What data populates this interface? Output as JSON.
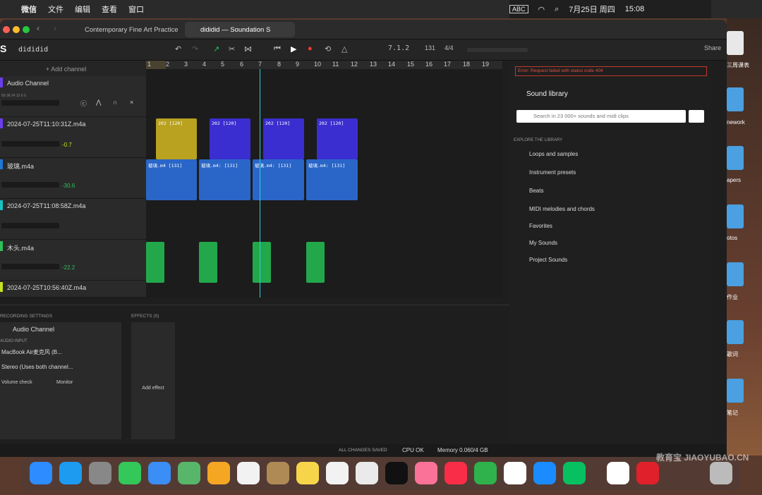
{
  "menubar": {
    "apple": "",
    "items": [
      "微信",
      "文件",
      "编辑",
      "查看",
      "窗口"
    ],
    "input": "ABC",
    "date": "7月25日 周四",
    "time": "15:08"
  },
  "browser": {
    "tab1": "Contemporary Fine Art Practice",
    "tab2": "dididid — Soundation S"
  },
  "app": {
    "project": "dididid",
    "position": "7.1.2",
    "bpm": "131",
    "time_sig": "4/4",
    "share": "Share"
  },
  "tracks": {
    "add": "+ Add channel",
    "list": [
      {
        "name": "Audio Channel",
        "db": "",
        "color": "#6b3cf0"
      },
      {
        "name": "2024-07-25T11:10:31Z.m4a",
        "db": "-0.7",
        "color": "#6b3cf0"
      },
      {
        "name": "玻璃.m4a",
        "db": "-30.6",
        "color": "#1e78d6"
      },
      {
        "name": "2024-07-25T11:08:58Z.m4a",
        "db": "",
        "color": "#19c2c2"
      },
      {
        "name": "木头.m4a",
        "db": "-22.2",
        "color": "#2ec05a"
      },
      {
        "name": "2024-07-25T10:56:40Z.m4a",
        "db": "",
        "color": "#c8e020"
      }
    ]
  },
  "ruler": [
    "1",
    "2",
    "3",
    "4",
    "5",
    "6",
    "7",
    "8",
    "9",
    "10",
    "11",
    "12",
    "13",
    "14",
    "15",
    "16",
    "17",
    "18",
    "19"
  ],
  "clips": {
    "a": "202 [120]",
    "b": "玻璃.m4 [131]",
    "b2": "玻璃.m4: [131]"
  },
  "library": {
    "error": "Error: Request failed with status code 404",
    "title": "Sound library",
    "search": "Search in 23 000+ sounds and midi clips",
    "explore": "EXPLORE THE LIBRARY",
    "items": [
      "Loops and samples",
      "Instrument presets",
      "Beats",
      "MIDI melodies and chords",
      "Favorites",
      "My Sounds",
      "Project Sounds"
    ]
  },
  "bottom": {
    "rec": "RECORDING SETTINGS",
    "channel": "Audio Channel",
    "input_label": "AUDIO INPUT",
    "input": "MacBook Air麦克风 (B...",
    "stereo": "Stereo (Uses both channel...",
    "vol": "Volume check",
    "mon": "Monitor",
    "effects": "EFFECTS (0)",
    "add": "Add effect"
  },
  "status": {
    "saved": "ALL CHANGES SAVED",
    "cpu": "CPU OK",
    "memory": "Memory 0.060/4 GB"
  },
  "desktop": [
    "三周课表",
    "nework",
    "apers",
    "otos",
    "作业",
    "歌词",
    "笔记"
  ],
  "watermark": "教育宝 JIAOYUBAO.CN"
}
